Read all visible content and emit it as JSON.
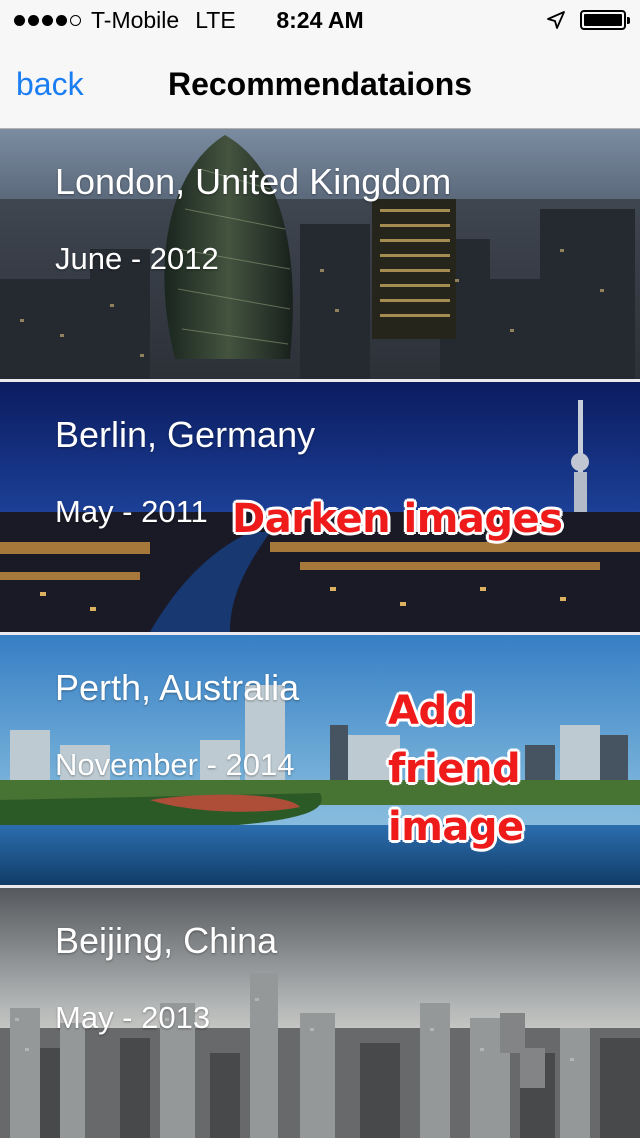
{
  "status_bar": {
    "carrier": "T-Mobile",
    "network": "LTE",
    "time": "8:24 AM",
    "signal_bars_filled": 4,
    "signal_bars_total": 5,
    "battery_level": 1.0,
    "icons": [
      "location-arrow-icon",
      "battery-icon"
    ]
  },
  "nav": {
    "back_label": "back",
    "title": "Recommendataions",
    "accent": "#1a7df2"
  },
  "recommendations": [
    {
      "city": "London, United Kingdom",
      "date": "June - 2012",
      "scene": "london-skyline-image"
    },
    {
      "city": "Berlin, Germany",
      "date": "May - 2011",
      "scene": "berlin-night-skyline-image"
    },
    {
      "city": "Perth, Australia",
      "date": "November - 2014",
      "scene": "perth-waterfront-image"
    },
    {
      "city": "Beijing, China",
      "date": "May - 2013",
      "scene": "beijing-skyline-image"
    }
  ],
  "annotations": {
    "darken": "Darken images",
    "friend_lines": [
      "Add",
      "friend",
      "image"
    ],
    "color": "#ef1b1b"
  }
}
